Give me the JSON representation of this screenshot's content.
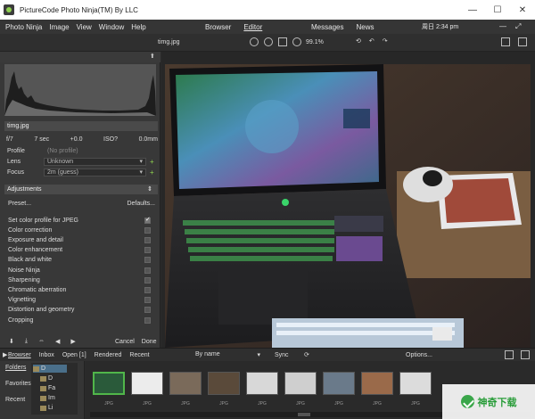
{
  "window": {
    "title": "PictureCode Photo Ninja(TM) By LLC",
    "controls": [
      "—",
      "☐",
      "✕"
    ]
  },
  "menu": {
    "left": [
      "Photo Ninja",
      "Image",
      "View",
      "Window",
      "Help"
    ],
    "center": [
      "Browser",
      "Editor"
    ],
    "right": [
      "Messages",
      "News"
    ],
    "time": "周日 2:34 pm"
  },
  "toolbar": {
    "filename": "timg.jpg",
    "zoom": "99.1%"
  },
  "left_panel": {
    "filename": "timg.jpg",
    "exif": [
      "f/7",
      "7 sec",
      "+0.0",
      "ISO?",
      "0.0mm"
    ],
    "profile_label": "Profile",
    "profile_value": "(No profile)",
    "lens_label": "Lens",
    "lens_value": "Unknown",
    "focus_label": "Focus",
    "focus_value": "2m (guess)",
    "adjustments_label": "Adjustments",
    "preset_label": "Preset...",
    "defaults_label": "Defaults...",
    "adjustments": [
      {
        "label": "Set color profile for JPEG",
        "checked": true
      },
      {
        "label": "Color correction",
        "checked": false
      },
      {
        "label": "Exposure and detail",
        "checked": false
      },
      {
        "label": "Color enhancement",
        "checked": false
      },
      {
        "label": "Black and white",
        "checked": false
      },
      {
        "label": "Noise Ninja",
        "checked": false
      },
      {
        "label": "Sharpening",
        "checked": false
      },
      {
        "label": "Chromatic aberration",
        "checked": false
      },
      {
        "label": "Vignetting",
        "checked": false
      },
      {
        "label": "Distortion and geometry",
        "checked": false
      },
      {
        "label": "Cropping",
        "checked": false
      }
    ],
    "cancel_label": "Cancel",
    "done_label": "Done"
  },
  "browser_bar": {
    "tabs": [
      "Browser",
      "Inbox",
      "Open [1]",
      "Rendered",
      "Recent"
    ],
    "sort": "By name",
    "sync": "Sync",
    "options": "Options..."
  },
  "folders": {
    "labels": [
      "Folders",
      "Favorites",
      "Recent"
    ],
    "nodes": [
      "D",
      "D",
      "Fa",
      "Im",
      "Li"
    ]
  },
  "thumbnails": {
    "caption": "JPG",
    "count": 9
  },
  "watermark": {
    "text": "神奇下载"
  }
}
